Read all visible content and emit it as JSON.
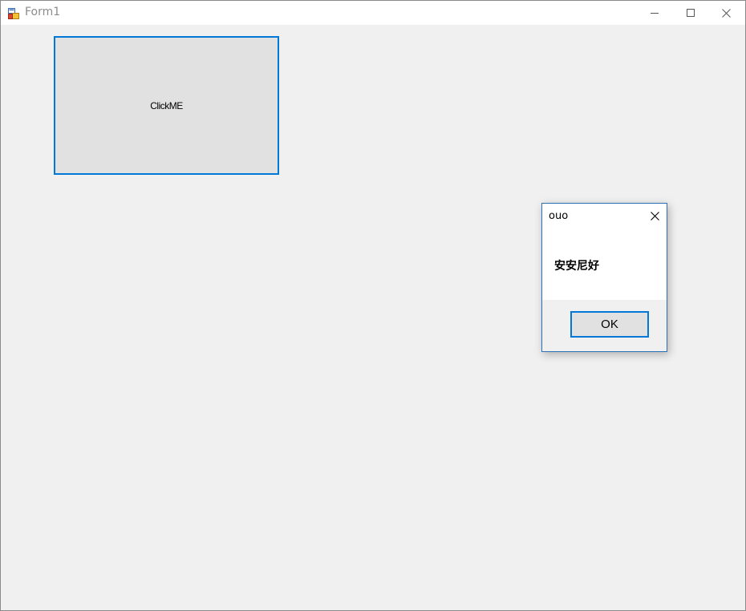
{
  "window": {
    "title": "Form1"
  },
  "main": {
    "clickme_label": "ClickME"
  },
  "messagebox": {
    "title": "ouo",
    "message": "安安尼好",
    "ok_label": "OK"
  },
  "colors": {
    "accent": "#0078d7",
    "button_face": "#e1e1e1",
    "client_bg": "#f0f0f0",
    "title_text": "#8c8c8c"
  },
  "icons": {
    "app": "winforms-app-icon",
    "minimize": "minimize-icon",
    "maximize": "maximize-icon",
    "close": "close-icon",
    "dialog_close": "close-icon"
  }
}
